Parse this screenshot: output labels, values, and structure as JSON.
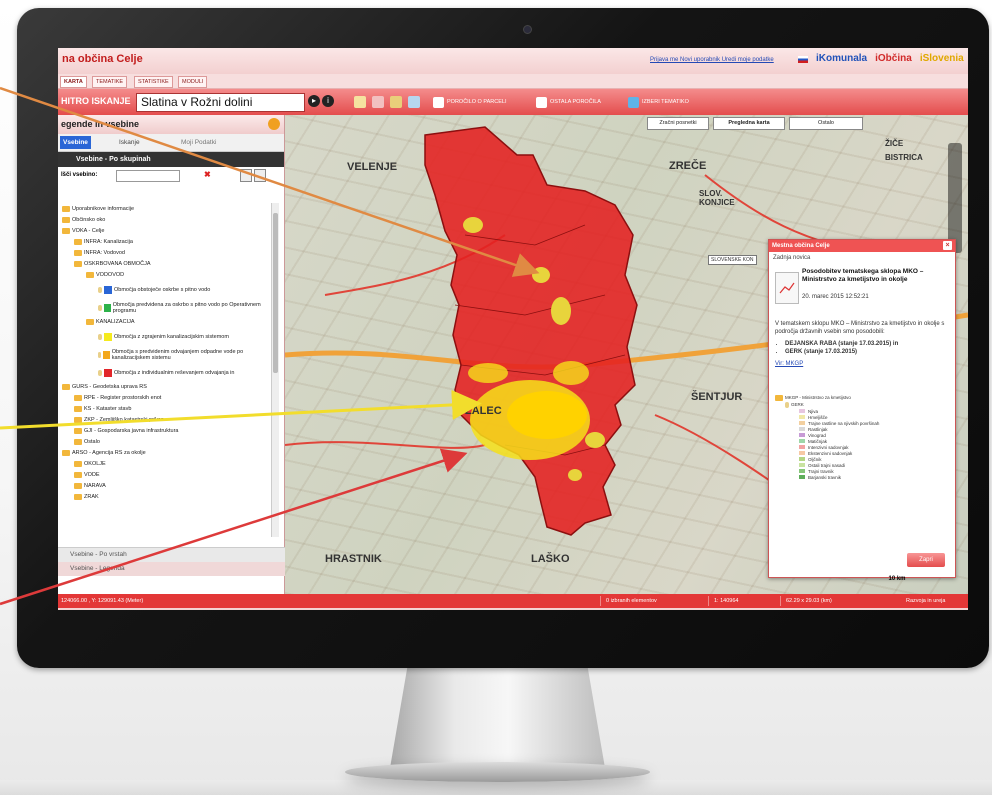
{
  "app": {
    "title": "na občina Celje",
    "header_links": "Prijava me Novi uporabnik Uredi moje podatke",
    "brands": [
      "iKomunala",
      "iObčina",
      "iSlovenia"
    ]
  },
  "tabs": [
    "KARTA",
    "TEMATIKE",
    "STATISTIKE",
    "MODULI"
  ],
  "toolbar": {
    "quick_search_label": "HITRO ISKANJE",
    "quick_search_value": "Slatina v Rožni dolini",
    "report_parcel": "POROČILO O PARCELI",
    "other_reports": "OSTALA POROČILA",
    "choose_thematic": "IZBERI TEMATIKO"
  },
  "left_panel": {
    "title": "egende in vsebine",
    "tabs": [
      "Vsebine",
      "Iskanje",
      "Moji Podatki"
    ],
    "group_header": "Vsebine - Po skupinah",
    "search_label": "Išči vsebino:",
    "tree": [
      {
        "label": "Uporabnikove informacije",
        "level": 0
      },
      {
        "label": "Občinsko oko",
        "level": 0
      },
      {
        "label": "VOKA - Celje",
        "level": 0
      },
      {
        "label": "INFRA: Kanalizacija",
        "level": 1
      },
      {
        "label": "INFRA: Vodovod",
        "level": 1
      },
      {
        "label": "OSKRBOVANA OBMOČJA",
        "level": 1
      },
      {
        "label": "VODOVOD",
        "level": 2
      },
      {
        "label": "Območja obstoječe oskrbe s pitno vodo",
        "level": 3,
        "color": "#2a66d6"
      },
      {
        "label": "Območja predvidena za oskrbo s pitno vodo po Operativnem programu",
        "level": 3,
        "color": "#2db24a"
      },
      {
        "label": "KANALIZACIJA",
        "level": 2
      },
      {
        "label": "Območja z zgrajenim kanalizacijskim sistemom",
        "level": 3,
        "color": "#f5ea1d"
      },
      {
        "label": "Območja s predvidenim odvajanjem odpadne vode po kanalizacijskem sistemu",
        "level": 3,
        "color": "#f3a81c"
      },
      {
        "label": "Območja z individualnim reševanjem odvajanja in",
        "level": 3,
        "color": "#e2262a"
      },
      {
        "label": "GURS - Geodetska uprava RS",
        "level": 0
      },
      {
        "label": "RPE - Register prostorskih enot",
        "level": 1
      },
      {
        "label": "KS - Kataster stavb",
        "level": 1
      },
      {
        "label": "ZKP - Zemljiško katastrski prikaz",
        "level": 1
      },
      {
        "label": "GJI - Gospodarska javna infrastruktura",
        "level": 1
      },
      {
        "label": "Ostalo",
        "level": 1
      },
      {
        "label": "ARSO - Agencija RS za okolje",
        "level": 0
      },
      {
        "label": "OKOLJE",
        "level": 1
      },
      {
        "label": "VODE",
        "level": 1
      },
      {
        "label": "NARAVA",
        "level": 1
      },
      {
        "label": "ZRAK",
        "level": 1
      }
    ],
    "footer1": "Vsebine - Po vrstah",
    "footer2": "Vsebine - Legenda"
  },
  "map": {
    "buttons": [
      "Zračni posnetki",
      "Pregledna karta",
      "Ostalo"
    ],
    "towns": [
      "VELENJE",
      "ZREČE",
      "SLOV. KONJICE",
      "ŽALEC",
      "ŠENTJUR",
      "LAŠKO",
      "HRASTNIK",
      "ŽIČE",
      "BISTRICA"
    ],
    "tooltip": "SLOVENSKE KON",
    "scale": "10 km"
  },
  "popup": {
    "title": "Mestna občina Celje",
    "section": "Zadnja novica",
    "news_title": "Posodobitev tematskega sklopa MKO – Ministrstvo za kmetijstvo in okolje",
    "news_date": "20. marec 2015 12:52:21",
    "body_intro": "V tematskem sklopu MKO – Ministrstvo za kmetijstvo in okolje s področja državnih vsebin smo posodobili:",
    "items": [
      "DEJANSKA RABA (stanje 17.03.2015) in",
      "GERK (stanje 17.03.2015)"
    ],
    "source": "Vir: MKGP",
    "legend_group": "MKGP - Ministrstvo za kmetijstvo",
    "legend_sub": "GERK",
    "legend": [
      {
        "label": "Njiva",
        "color": "#e7c6e0"
      },
      {
        "label": "Hmeljišče",
        "color": "#f0e8a8"
      },
      {
        "label": "Trajne rastline na njivskih površinah",
        "color": "#f3d0a0"
      },
      {
        "label": "Rastlinjak",
        "color": "#d9d9d9"
      },
      {
        "label": "Vinograd",
        "color": "#c79bd6"
      },
      {
        "label": "Matičnjak",
        "color": "#9ed7a8"
      },
      {
        "label": "Intenzivni sadovnjak",
        "color": "#f2a3a3"
      },
      {
        "label": "Ekstenzivni sadovnjak",
        "color": "#f7c9a5"
      },
      {
        "label": "Oljčnik",
        "color": "#b5d685"
      },
      {
        "label": "Ostali trajni nasadi",
        "color": "#c9e3a1"
      },
      {
        "label": "Trajni travnik",
        "color": "#87c77a"
      },
      {
        "label": "Barjanski travnik",
        "color": "#5fae5b"
      }
    ],
    "close_label": "Zapri"
  },
  "status": {
    "coords": "124066.00 , Y: 129091.43 (Meter)",
    "selected": "0 izbranih elementov",
    "scale": "1: 140964",
    "area": "62.29 x 29.03 (km)",
    "version": "Razvoja in ureja"
  },
  "colors": {
    "accent": "#e33737",
    "header_text": "#c21d1d",
    "region_red": "#e42020",
    "highlight_yellow": "#f6e01a"
  }
}
